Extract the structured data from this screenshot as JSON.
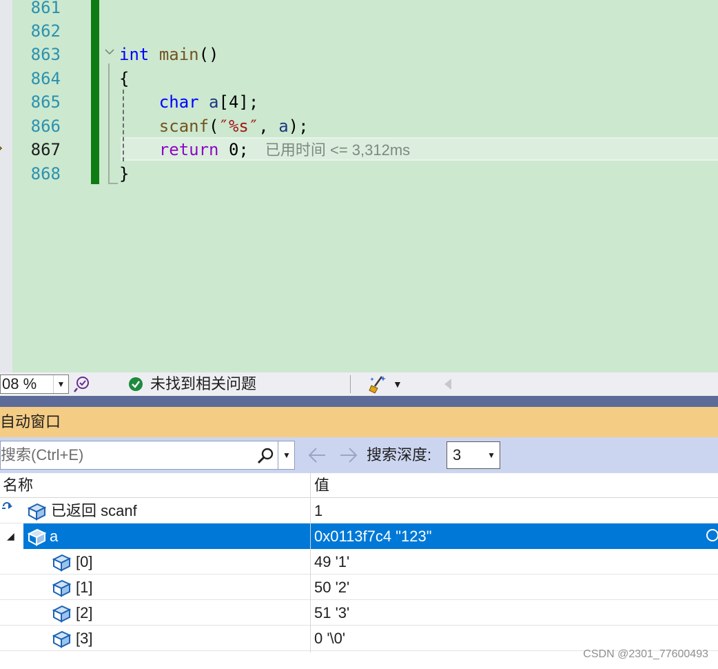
{
  "editor": {
    "lines": [
      {
        "num": "861",
        "code": []
      },
      {
        "num": "862",
        "code": []
      },
      {
        "num": "863",
        "code": [
          {
            "t": "int",
            "c": "kw"
          },
          {
            "t": " ",
            "c": "plain"
          },
          {
            "t": "main",
            "c": "fn"
          },
          {
            "t": "()",
            "c": "plain"
          }
        ]
      },
      {
        "num": "864",
        "code": [
          {
            "t": "{",
            "c": "plain"
          }
        ]
      },
      {
        "num": "865",
        "code": [
          {
            "t": "    ",
            "c": "plain"
          },
          {
            "t": "char",
            "c": "kw"
          },
          {
            "t": " ",
            "c": "plain"
          },
          {
            "t": "a",
            "c": "var"
          },
          {
            "t": "[4];",
            "c": "plain"
          }
        ]
      },
      {
        "num": "866",
        "code": [
          {
            "t": "    ",
            "c": "plain"
          },
          {
            "t": "scanf",
            "c": "fn"
          },
          {
            "t": "(",
            "c": "plain"
          },
          {
            "t": "″%s″",
            "c": "str"
          },
          {
            "t": ", ",
            "c": "plain"
          },
          {
            "t": "a",
            "c": "var"
          },
          {
            "t": ");",
            "c": "plain"
          }
        ]
      },
      {
        "num": "867",
        "code": [
          {
            "t": "    ",
            "c": "plain"
          },
          {
            "t": "return",
            "c": "ctl"
          },
          {
            "t": " 0;",
            "c": "plain"
          }
        ],
        "hint": "已用时间 <= 3,312ms",
        "current": true
      },
      {
        "num": "868",
        "code": [
          {
            "t": "}",
            "c": "plain"
          }
        ]
      }
    ]
  },
  "status": {
    "zoom": "08 %",
    "issues": "未找到相关问题"
  },
  "autos": {
    "title": "自动窗口",
    "search_placeholder": "搜索(Ctrl+E)",
    "depth_label": "搜索深度:",
    "depth_value": "3",
    "columns": {
      "name": "名称",
      "value": "值"
    },
    "rows": [
      {
        "name": "已返回 scanf",
        "value": "1"
      },
      {
        "name": "a",
        "value": "0x0113f7c4 \"123\""
      },
      {
        "name": "[0]",
        "value": "49 '1'"
      },
      {
        "name": "[1]",
        "value": "50 '2'"
      },
      {
        "name": "[2]",
        "value": "51 '3'"
      },
      {
        "name": "[3]",
        "value": "0 '\\0'"
      }
    ]
  },
  "watermark": "CSDN @2301_77600493",
  "colors": {
    "editor_bg": "#cce8cf",
    "change_bar": "#0f7b13",
    "autos_header": "#f5cc84",
    "selection": "#0078d7"
  }
}
